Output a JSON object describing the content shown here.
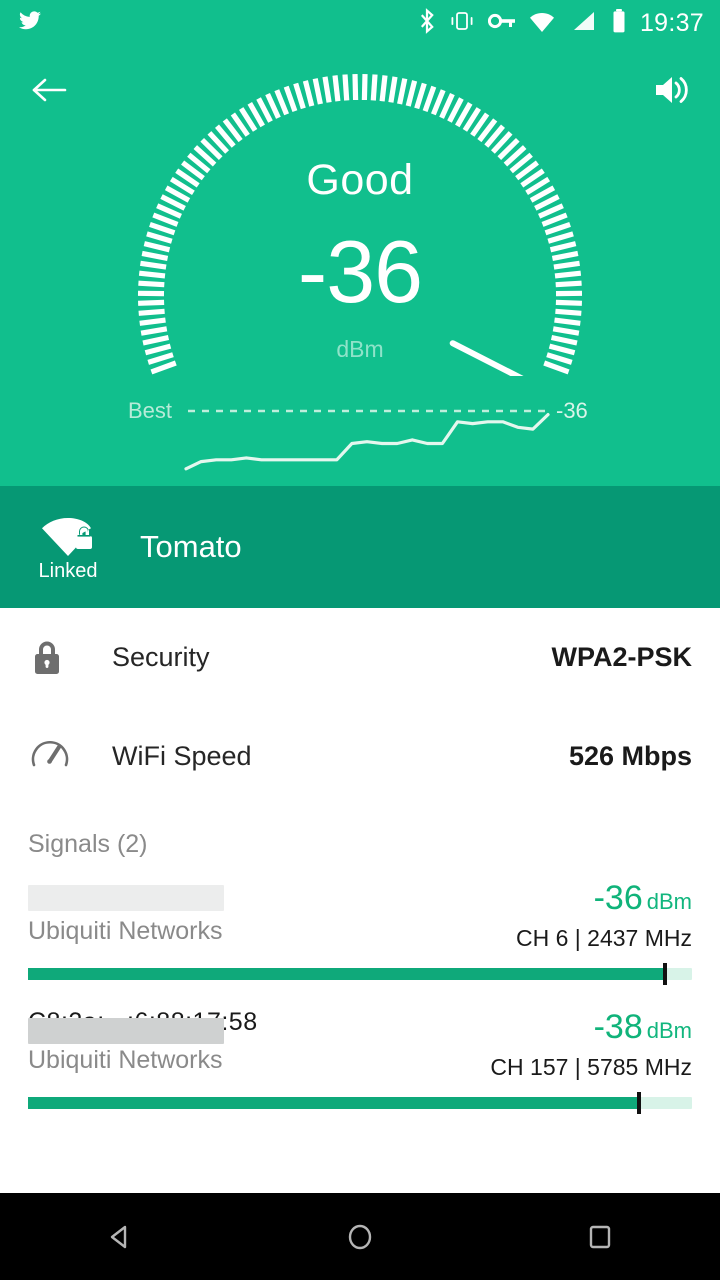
{
  "status_bar": {
    "time": "19:37",
    "app_icon": "twitter-bird-icon",
    "icons": [
      "bluetooth-icon",
      "vibrate-icon",
      "vpn-key-icon",
      "wifi-off-icon",
      "cellular-signal-icon",
      "battery-icon"
    ]
  },
  "header": {
    "back_icon": "back-arrow-icon",
    "volume_icon": "volume-up-icon",
    "gauge": {
      "quality_label": "Good",
      "value": "-36",
      "unit": "dBm"
    },
    "sparkline": {
      "best_label": "Best",
      "current_label": "-36"
    }
  },
  "linked": {
    "badge_label": "Linked",
    "ssid": "Tomato",
    "icon": "wifi-lock-icon"
  },
  "info_rows": [
    {
      "icon": "lock-icon",
      "label": "Security",
      "value": "WPA2-PSK"
    },
    {
      "icon": "speedometer-icon",
      "label": "WiFi Speed",
      "value": "526 Mbps"
    }
  ],
  "signals": {
    "title": "Signals (2)",
    "items": [
      {
        "ssid": "",
        "redacted": true,
        "redact_width": 196,
        "redact_color": "#ECEDED",
        "vendor": "Ubiquiti Networks",
        "dbm": "-36",
        "dbm_unit": "dBm",
        "channel": "CH 6 | 2437 MHz",
        "bar_percent": 96
      },
      {
        "ssid": "C8:2a:...:6:88:17:58",
        "redacted": true,
        "redact_width": 196,
        "redact_color": "#CFD1D1",
        "vendor": "Ubiquiti Networks",
        "dbm": "-38",
        "dbm_unit": "dBm",
        "channel": "CH 157 | 5785 MHz",
        "bar_percent": 92
      }
    ]
  },
  "navigation_bar": {
    "back": "nav-back-icon",
    "home": "nav-home-icon",
    "recents": "nav-recents-icon"
  },
  "colors": {
    "brand_green": "#11BF8D",
    "dark_green": "#069874",
    "accent_green": "#10B37A",
    "bar_track": "#D8F3E8"
  },
  "chart_data": {
    "type": "line",
    "title": "",
    "xlabel": "",
    "ylabel": "dBm",
    "annotations": [
      "Best",
      "-36"
    ],
    "grid": false,
    "legend": "none",
    "series": [
      {
        "name": "signal_history",
        "values": [
          -66,
          -62,
          -61,
          -61,
          -60,
          -61,
          -61,
          -61,
          -61,
          -61,
          -61,
          -52,
          -51,
          -52,
          -52,
          -50,
          -52,
          -52,
          -40,
          -41,
          -40,
          -40,
          -43,
          -44,
          -36
        ]
      }
    ],
    "reference_line": {
      "label": "Best",
      "value": -36,
      "style": "dashed"
    },
    "ylim": [
      -70,
      -34
    ]
  }
}
